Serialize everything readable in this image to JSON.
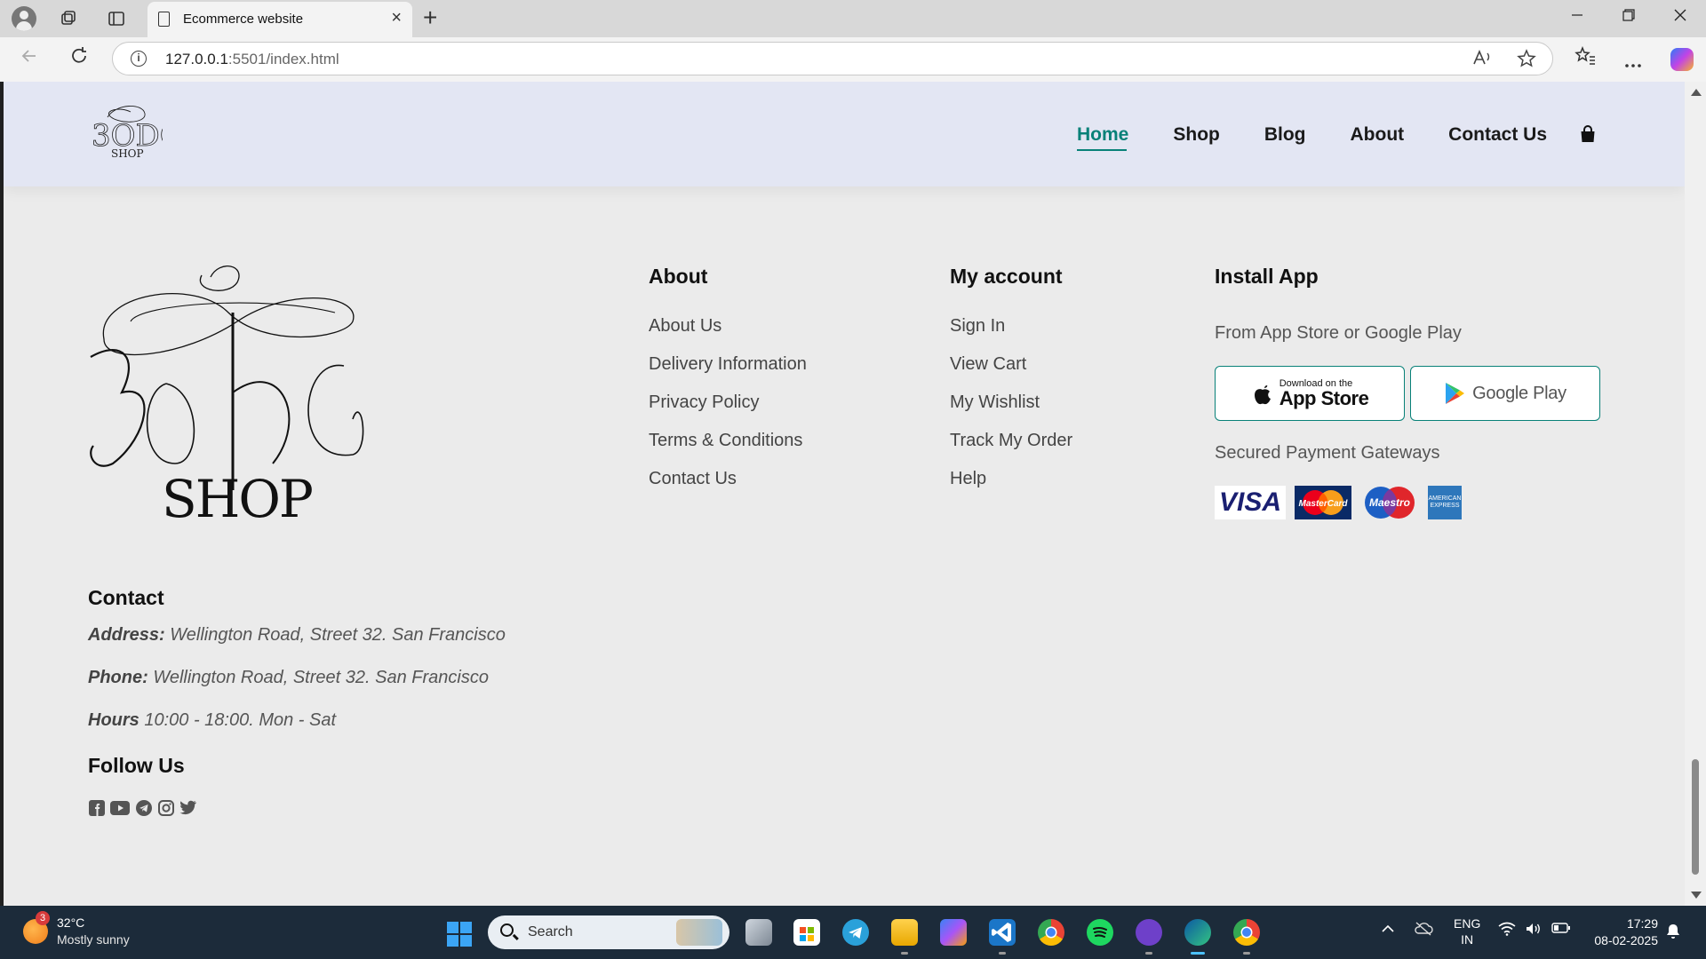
{
  "browser": {
    "tab_title": "Ecommerce website",
    "url_host": "127.0.0.1",
    "url_rest": ":5501/index.html",
    "close_glyph": "×",
    "new_tab_glyph": "+"
  },
  "site": {
    "accent": "#088178",
    "nav": [
      {
        "label": "Home",
        "active": true
      },
      {
        "label": "Shop"
      },
      {
        "label": "Blog"
      },
      {
        "label": "About"
      },
      {
        "label": "Contact Us"
      }
    ],
    "cart_icon": "shopping-bag-icon"
  },
  "footer": {
    "about": {
      "title": "About",
      "links": [
        "About Us",
        "Delivery Information",
        "Privacy Policy",
        "Terms & Conditions",
        "Contact Us"
      ]
    },
    "account": {
      "title": "My account",
      "links": [
        "Sign In",
        "View Cart",
        "My Wishlist",
        "Track My Order",
        "Help"
      ]
    },
    "install": {
      "title": "Install App",
      "subtitle": "From App Store or Google Play",
      "appstore_small": "Download on the",
      "appstore_big": "App Store",
      "gplay": "Google Play",
      "payments_title": "Secured Payment Gateways",
      "payments": {
        "visa": "VISA",
        "mastercard": "MasterCard",
        "maestro": "Maestro",
        "amex": "AMERICAN EXPRESS"
      }
    },
    "contact": {
      "title": "Contact",
      "address_label": "Address:",
      "address_value": " Wellington Road, Street 32. San Francisco",
      "phone_label": "Phone:",
      "phone_value": " Wellington Road, Street 32. San Francisco",
      "hours_label": "Hours",
      "hours_value": " 10:00 - 18:00. Mon - Sat"
    },
    "follow": {
      "title": "Follow Us",
      "icons": [
        "facebook-icon",
        "youtube-icon",
        "telegram-icon",
        "instagram-icon",
        "twitter-icon"
      ]
    }
  },
  "taskbar": {
    "weather_badge": "3",
    "weather_temp": "32°C",
    "weather_desc": "Mostly sunny",
    "search_placeholder": "Search",
    "lang_1": "ENG",
    "lang_2": "IN",
    "time": "17:29",
    "date": "08-02-2025"
  }
}
